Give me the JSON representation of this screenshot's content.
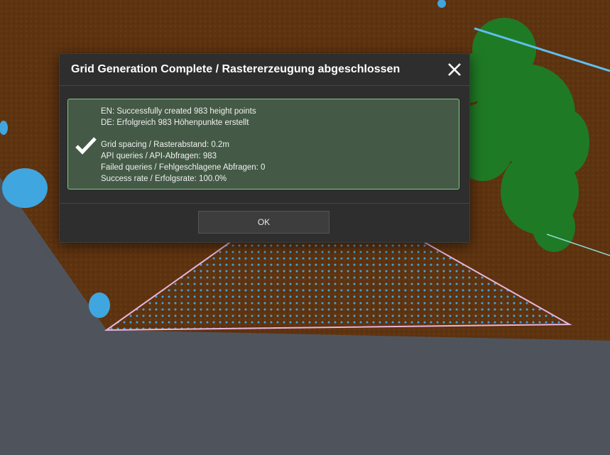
{
  "dialog": {
    "title": "Grid Generation Complete / Rastererzeugung abgeschlossen",
    "close_icon": "close-icon",
    "status_icon": "checkmark-icon",
    "messages": {
      "en_line": "EN: Successfully created 983 height points",
      "de_line": "DE: Erfolgreich 983 Höhenpunkte erstellt",
      "grid_spacing": "Grid spacing / Rasterabstand: 0.2m",
      "api_queries": "API queries / API-Abfragen: 983",
      "failed_queries": "Failed queries / Fehlgeschlagene Abfragen: 0",
      "success_rate": "Success rate / Erfolgsrate: 100.0%"
    },
    "ok_label": "OK"
  },
  "colors": {
    "ground": "#5e3310",
    "vegetation": "#1f7a25",
    "points": "#3fa6e0",
    "selection_outline": "#e8b4dc",
    "success_border": "#86c48a",
    "success_background": "#445a46"
  }
}
